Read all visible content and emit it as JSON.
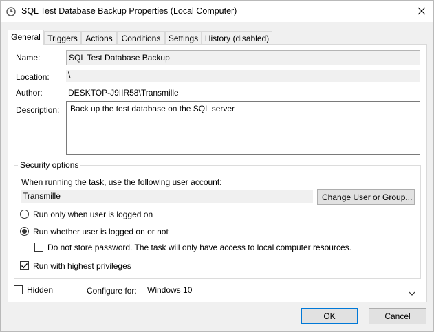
{
  "window": {
    "title": "SQL Test Database Backup Properties (Local Computer)",
    "icons": {
      "app": "clock-task-icon",
      "close": "close-icon"
    }
  },
  "tabs": [
    {
      "label": "General",
      "active": true
    },
    {
      "label": "Triggers"
    },
    {
      "label": "Actions"
    },
    {
      "label": "Conditions"
    },
    {
      "label": "Settings"
    },
    {
      "label": "History (disabled)"
    }
  ],
  "general": {
    "name_label": "Name:",
    "name_value": "SQL Test Database Backup",
    "location_label": "Location:",
    "location_value": "\\",
    "author_label": "Author:",
    "author_value": "DESKTOP-J9IIR58\\Transmille",
    "description_label": "Description:",
    "description_value": "Back up the test database on the SQL server"
  },
  "security": {
    "group_title": "Security options",
    "account_prompt": "When running the task, use the following user account:",
    "account_value": "Transmille",
    "change_button": "Change User or Group...",
    "radio_logged_on": {
      "label": "Run only when user is logged on",
      "checked": false
    },
    "radio_whether": {
      "label": "Run whether user is logged on or not",
      "checked": true
    },
    "no_store_password": {
      "label": "Do not store password.  The task will only have access to local computer resources.",
      "checked": false
    },
    "highest_privileges": {
      "label": "Run with highest privileges",
      "checked": true
    }
  },
  "bottom": {
    "hidden": {
      "label": "Hidden",
      "checked": false
    },
    "configure_label": "Configure for:",
    "configure_value": "Windows 10"
  },
  "buttons": {
    "ok": "OK",
    "cancel": "Cancel"
  },
  "colors": {
    "accent": "#0078d7",
    "panel": "#ffffff",
    "chrome": "#f0f0f0"
  }
}
